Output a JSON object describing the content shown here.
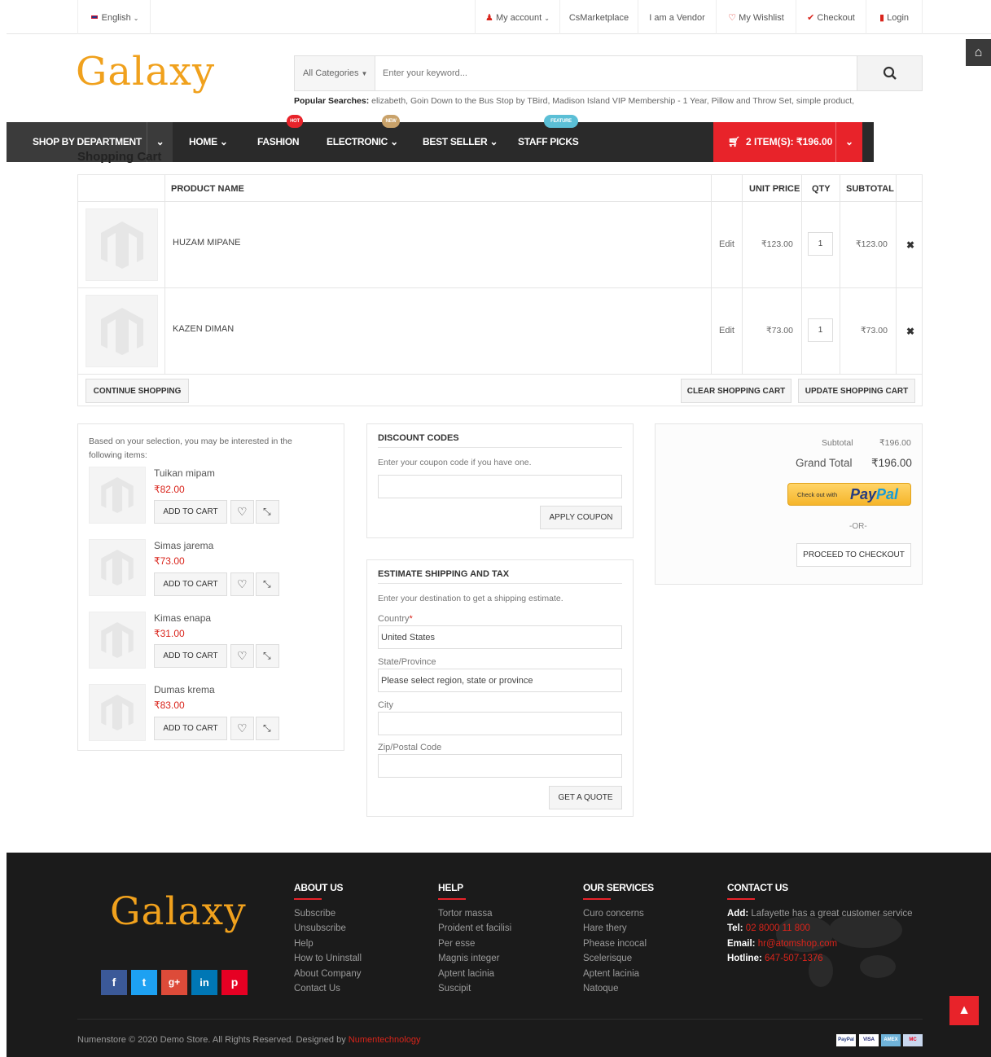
{
  "topbar": {
    "language": "English",
    "links": [
      "My account",
      "CsMarketplace",
      "I am a Vendor",
      "My Wishlist",
      "Checkout",
      "Login"
    ]
  },
  "logo": "Galaxy",
  "search": {
    "category": "All Categories",
    "placeholder": "Enter your keyword...",
    "popular_label": "Popular Searches:",
    "popular_terms": "elizabeth, Goin Down to the Bus Stop by TBird, Madison Island VIP Membership - 1 Year, Pillow and Throw Set, simple product,"
  },
  "nav": {
    "department": "SHOP BY DEPARTMENT",
    "items": [
      "HOME",
      "FASHION",
      "ELECTRONIC",
      "BEST SELLER",
      "STAFF PICKS"
    ],
    "badges": {
      "hot": "HOT",
      "new": "NEW",
      "feature": "FEATURE"
    },
    "cart": "2 ITEM(S): ₹196.00"
  },
  "page_title": "Shopping Cart",
  "cart_table": {
    "headers": {
      "name": "PRODUCT NAME",
      "unit_price": "UNIT PRICE",
      "qty": "QTY",
      "subtotal": "SUBTOTAL"
    },
    "rows": [
      {
        "name": "HUZAM MIPANE",
        "edit": "Edit",
        "price": "₹123.00",
        "qty": "1",
        "subtotal": "₹123.00"
      },
      {
        "name": "KAZEN DIMAN",
        "edit": "Edit",
        "price": "₹73.00",
        "qty": "1",
        "subtotal": "₹73.00"
      }
    ],
    "continue": "CONTINUE SHOPPING",
    "clear": "CLEAR SHOPPING CART",
    "update": "UPDATE SHOPPING CART"
  },
  "crosssell": {
    "intro": "Based on your selection, you may be interested in the following items:",
    "add_to_cart": "ADD TO CART",
    "items": [
      {
        "name": "Tuikan mipam",
        "price": "₹82.00"
      },
      {
        "name": "Simas jarema",
        "price": "₹73.00"
      },
      {
        "name": "Kimas enapa",
        "price": "₹31.00"
      },
      {
        "name": "Dumas krema",
        "price": "₹83.00"
      }
    ]
  },
  "discount": {
    "title": "DISCOUNT CODES",
    "hint": "Enter your coupon code if you have one.",
    "apply": "APPLY COUPON"
  },
  "shipping": {
    "title": "ESTIMATE SHIPPING AND TAX",
    "hint": "Enter your destination to get a shipping estimate.",
    "country_label": "Country",
    "required": "*",
    "country": "United States",
    "state_label": "State/Province",
    "state": "Please select region, state or province",
    "city_label": "City",
    "zip_label": "Zip/Postal Code",
    "quote": "GET A QUOTE"
  },
  "totals": {
    "subtotal_label": "Subtotal",
    "subtotal": "₹196.00",
    "grand_label": "Grand Total",
    "grand": "₹196.00",
    "paypal_prefix": "Check out with",
    "paypal_pay": "Pay",
    "paypal_pal": "Pal",
    "or": "-OR-",
    "checkout": "PROCEED TO CHECKOUT"
  },
  "footer": {
    "about": {
      "title": "ABOUT US",
      "links": [
        "Subscribe",
        "Unsubscribe",
        "Help",
        "How to Uninstall",
        "About Company",
        "Contact Us"
      ]
    },
    "help": {
      "title": "HELP",
      "links": [
        "Tortor massa",
        "Proident et facilisi",
        "Per esse",
        "Magnis integer",
        "Aptent lacinia",
        "Suscipit"
      ]
    },
    "services": {
      "title": "OUR SERVICES",
      "links": [
        "Curo concerns",
        "Hare thery",
        "Phease incocal",
        "Scelerisque",
        "Aptent lacinia",
        "Natoque"
      ]
    },
    "contact": {
      "title": "CONTACT US",
      "add_label": "Add:",
      "add": "Lafayette has a great customer service",
      "tel_label": "Tel:",
      "tel": "02 8000 11 800",
      "email_label": "Email:",
      "email": "hr@atomshop.com",
      "hotline_label": "Hotline:",
      "hotline": "647-507-1376"
    },
    "social": [
      "f",
      "t",
      "g+",
      "in",
      "p"
    ],
    "copyright": "Numenstore © 2020 Demo Store. All Rights Reserved. Designed by",
    "designer": "Numentechnology",
    "payments": [
      "PayPal",
      "VISA",
      "AMEX",
      "MC"
    ]
  },
  "colors": {
    "accent": "#e8232a",
    "nav_bg": "#2a2a2a",
    "footer_bg": "#1b1b1b",
    "logo": "#f0a11d"
  }
}
